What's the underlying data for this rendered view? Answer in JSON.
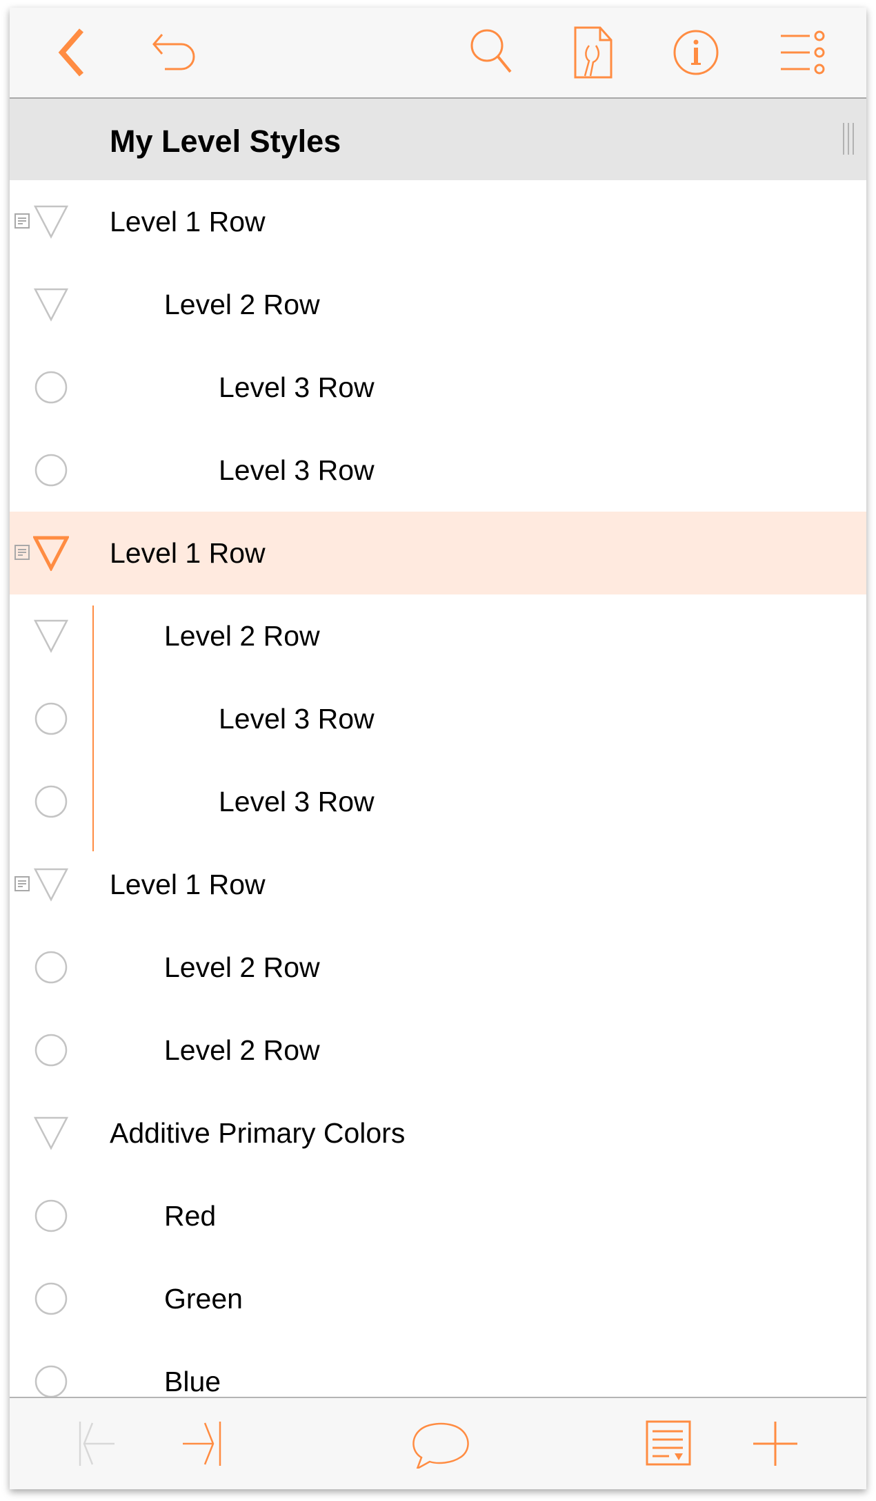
{
  "colors": {
    "accent": "#ff8c42",
    "selected_row": "#ffeadf",
    "disabled": "#d8d8d8",
    "control_gray": "#c4c4c4"
  },
  "toolbar": {
    "icons": [
      "back-chevron-icon",
      "undo-icon",
      "search-icon",
      "document-wrench-icon",
      "info-icon",
      "list-options-icon"
    ]
  },
  "header": {
    "title": "My Level Styles"
  },
  "rows": [
    {
      "label": "Level 1 Row",
      "level": 1,
      "control": "triangle",
      "has_note": true,
      "selected": false
    },
    {
      "label": "Level 2 Row",
      "level": 2,
      "control": "triangle",
      "has_note": false,
      "selected": false
    },
    {
      "label": "Level 3 Row",
      "level": 3,
      "control": "circle",
      "has_note": false,
      "selected": false
    },
    {
      "label": "Level 3 Row",
      "level": 3,
      "control": "circle",
      "has_note": false,
      "selected": false
    },
    {
      "label": "Level 1 Row",
      "level": 1,
      "control": "triangle",
      "has_note": true,
      "selected": true
    },
    {
      "label": "Level 2 Row",
      "level": 2,
      "control": "triangle",
      "has_note": false,
      "selected": false
    },
    {
      "label": "Level 3 Row",
      "level": 3,
      "control": "circle",
      "has_note": false,
      "selected": false
    },
    {
      "label": "Level 3 Row",
      "level": 3,
      "control": "circle",
      "has_note": false,
      "selected": false
    },
    {
      "label": "Level 1 Row",
      "level": 1,
      "control": "triangle",
      "has_note": true,
      "selected": false
    },
    {
      "label": "Level 2 Row",
      "level": 2,
      "control": "circle",
      "has_note": false,
      "selected": false
    },
    {
      "label": "Level 2 Row",
      "level": 2,
      "control": "circle",
      "has_note": false,
      "selected": false
    },
    {
      "label": "Additive Primary Colors",
      "level": 1,
      "control": "triangle",
      "has_note": false,
      "selected": false
    },
    {
      "label": "Red",
      "level": 2,
      "control": "circle",
      "has_note": false,
      "selected": false
    },
    {
      "label": "Green",
      "level": 2,
      "control": "circle",
      "has_note": false,
      "selected": false
    },
    {
      "label": "Blue",
      "level": 2,
      "control": "circle",
      "has_note": false,
      "selected": false
    }
  ],
  "bottom_toolbar": {
    "icons": [
      "outdent-icon",
      "indent-icon",
      "comment-icon",
      "note-icon",
      "add-row-icon"
    ],
    "outdent_enabled": false
  }
}
